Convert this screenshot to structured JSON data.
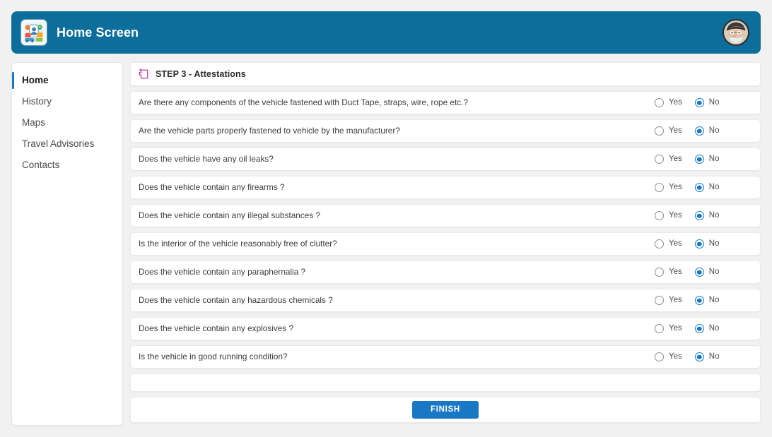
{
  "header": {
    "title": "Home Screen",
    "app_icon": "travel-app-icon",
    "avatar": "user-avatar",
    "background_color": "#0d6e9c"
  },
  "sidebar": {
    "items": [
      {
        "label": "Home",
        "active": true
      },
      {
        "label": "History",
        "active": false
      },
      {
        "label": "Maps",
        "active": false
      },
      {
        "label": "Travel Advisories",
        "active": false
      },
      {
        "label": "Contacts",
        "active": false
      }
    ],
    "active_indicator_color": "#1878c6"
  },
  "main": {
    "step_icon": "steps-icon",
    "step_title": "STEP 3 - Attestations",
    "option_yes": "Yes",
    "option_no": "No",
    "questions": [
      {
        "text": "Are there any components of the vehicle fastened with Duct Tape, straps, wire, rope etc.?",
        "answer": "No"
      },
      {
        "text": "Are the vehicle parts properly fastened to vehicle by the manufacturer?",
        "answer": "No"
      },
      {
        "text": "Does the vehicle have any oil leaks?",
        "answer": "No"
      },
      {
        "text": "Does the vehicle contain any firearms ?",
        "answer": "No"
      },
      {
        "text": "Does the vehicle contain any illegal substances ?",
        "answer": "No"
      },
      {
        "text": "Is the interior of the vehicle reasonably free of clutter?",
        "answer": "No"
      },
      {
        "text": "Does the vehicle contain any paraphernalia ?",
        "answer": "No"
      },
      {
        "text": "Does the vehicle contain any hazardous chemicals ?",
        "answer": "No"
      },
      {
        "text": "Does the vehicle contain any explosives ?",
        "answer": "No"
      },
      {
        "text": "Is the vehicle in good running condition?",
        "answer": "No"
      }
    ],
    "finish_label": "FINISH",
    "finish_color": "#1878c6"
  }
}
